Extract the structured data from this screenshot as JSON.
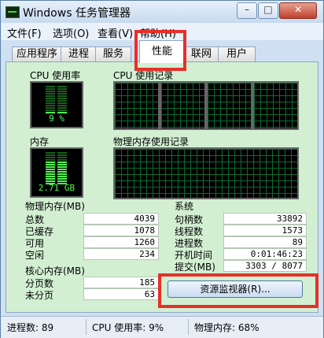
{
  "window": {
    "title": "Windows 任务管理器"
  },
  "controls": {
    "minimize": "–",
    "maximize": "□",
    "close": "✕"
  },
  "menu": [
    "文件(F)",
    "选项(O)",
    "查看(V)",
    "帮助(H)"
  ],
  "tabs": [
    "应用程序",
    "进程",
    "服务",
    "性能",
    "联网",
    "用户"
  ],
  "active_tab": "性能",
  "cpu": {
    "label": "CPU 使用率",
    "value": "9 %",
    "history_label": "CPU 使用记录"
  },
  "memory": {
    "label": "内存",
    "value": "2.71 GB",
    "history_label": "物理内存使用记录"
  },
  "physical_memory": {
    "title": "物理内存(MB)",
    "rows": [
      {
        "label": "总数",
        "value": "4039"
      },
      {
        "label": "已缓存",
        "value": "1078"
      },
      {
        "label": "可用",
        "value": "1260"
      },
      {
        "label": "空闲",
        "value": "234"
      }
    ]
  },
  "kernel_memory": {
    "title": "核心内存(MB)",
    "rows": [
      {
        "label": "分页数",
        "value": "185"
      },
      {
        "label": "未分页",
        "value": "63"
      }
    ]
  },
  "system": {
    "title": "系统",
    "rows": [
      {
        "label": "句柄数",
        "value": "33892"
      },
      {
        "label": "线程数",
        "value": "1573"
      },
      {
        "label": "进程数",
        "value": "89"
      },
      {
        "label": "开机时间",
        "value": "0:01:46:23"
      },
      {
        "label": "提交(MB)",
        "value": "3303 / 8077"
      }
    ]
  },
  "resource_monitor_button": "资源监视器(R)...",
  "status": {
    "processes": "进程数: 89",
    "cpu": "CPU 使用率: 9%",
    "memory": "物理内存: 68%"
  },
  "colors": {
    "graph_bg": "#000000",
    "graph_grid": "#0b6b2e",
    "gauge_green": "#4eff4e",
    "highlight": "#e5302a",
    "panel_bg": "#d2efd2"
  }
}
